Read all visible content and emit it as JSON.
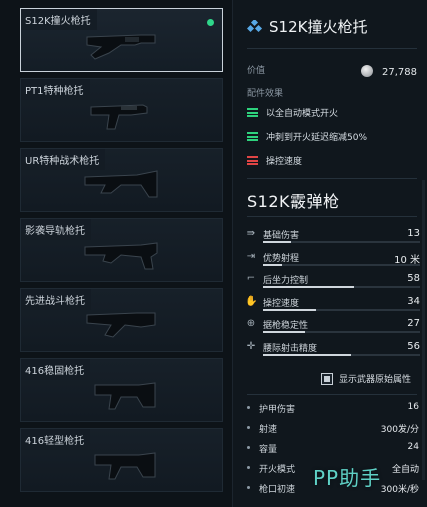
{
  "list": {
    "items": [
      {
        "label": "S12K撞火枪托",
        "selected": true,
        "equipped": true
      },
      {
        "label": "PT1特种枪托",
        "selected": false
      },
      {
        "label": "UR特种战术枪托",
        "selected": false
      },
      {
        "label": "影袭导轨枪托",
        "selected": false
      },
      {
        "label": "先进战斗枪托",
        "selected": false
      },
      {
        "label": "416稳固枪托",
        "selected": false
      },
      {
        "label": "416轻型枪托",
        "selected": false
      }
    ]
  },
  "detail": {
    "title": "S12K撞火枪托",
    "value_label": "价值",
    "value": "27,788",
    "effects_label": "配件效果",
    "effects": [
      {
        "text": "以全自动模式开火",
        "type": "positive"
      },
      {
        "text": "冲刺到开火延迟缩减50%",
        "type": "positive"
      },
      {
        "text": "操控速度",
        "type": "negative"
      }
    ],
    "weapon_name": "S12K霰弹枪",
    "stats": [
      {
        "name": "基础伤害",
        "value": "13",
        "icon": "damage-icon",
        "glyph": "⇛",
        "level": 0.18
      },
      {
        "name": "优势射程",
        "value": "10 米",
        "icon": "range-icon",
        "glyph": "⇥",
        "level": 0.12
      },
      {
        "name": "后坐力控制",
        "value": "58",
        "icon": "recoil-icon",
        "glyph": "⌐",
        "level": 0.58
      },
      {
        "name": "操控速度",
        "value": "34",
        "icon": "handling-icon",
        "glyph": "✋",
        "level": 0.34
      },
      {
        "name": "据枪稳定性",
        "value": "27",
        "icon": "stability-icon",
        "glyph": "⊕",
        "level": 0.27
      },
      {
        "name": "腰际射击精度",
        "value": "56",
        "icon": "hipfire-icon",
        "glyph": "✛",
        "level": 0.56
      }
    ],
    "show_original_label": "显示武器原始属性",
    "attributes": [
      {
        "name": "护甲伤害",
        "value": "16"
      },
      {
        "name": "射速",
        "value": "300发/分"
      },
      {
        "name": "容量",
        "value": "24"
      },
      {
        "name": "开火模式",
        "value": "全自动"
      },
      {
        "name": "枪口初速",
        "value": "300米/秒"
      }
    ]
  },
  "watermark": "PP助手",
  "colors": {
    "positive": "#2ed27d",
    "negative": "#e04545",
    "accent": "#58a9e6"
  }
}
